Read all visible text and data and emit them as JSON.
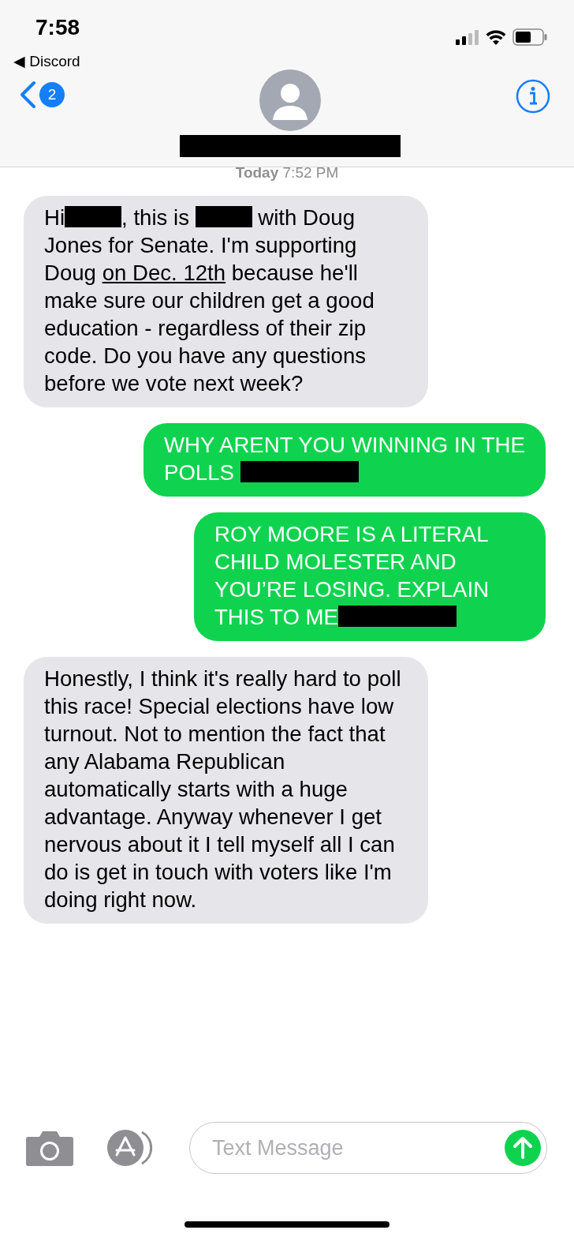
{
  "status_bar": {
    "time": "7:58",
    "back_app": "◀ Discord"
  },
  "header": {
    "unread_count": "2"
  },
  "timestamp": {
    "day": "Today",
    "time": "7:52 PM"
  },
  "messages": [
    {
      "sent": false,
      "parts": [
        {
          "kind": "text",
          "text": "Hi"
        },
        {
          "kind": "redaction"
        },
        {
          "kind": "text",
          "text": ", this is "
        },
        {
          "kind": "redaction"
        },
        {
          "kind": "text",
          "text": " with Doug Jones for Senate. I'm supporting Doug "
        },
        {
          "kind": "link",
          "text": "on Dec. 12th"
        },
        {
          "kind": "text",
          "text": " because he'll make sure our children get a good education - regardless of their zip code. Do you have any questions before we vote next week?"
        }
      ]
    },
    {
      "sent": true,
      "parts": [
        {
          "kind": "text",
          "text": "WHY ARENT YOU WINNING IN THE POLLS "
        },
        {
          "kind": "redaction"
        }
      ]
    },
    {
      "sent": true,
      "parts": [
        {
          "kind": "text",
          "text": "ROY MOORE IS A LITERAL CHILD MOLESTER AND YOU’RE LOSING. EXPLAIN THIS TO ME"
        },
        {
          "kind": "redaction"
        }
      ]
    },
    {
      "sent": false,
      "parts": [
        {
          "kind": "text",
          "text": "Honestly, I think it's really hard to poll this race! Special elections have low turnout. Not to mention the fact that any Alabama Republican automatically starts with a huge advantage. Anyway whenever I get nervous about it I tell myself all I can do is get in touch with voters like I'm doing right now."
        }
      ]
    }
  ],
  "composer": {
    "placeholder": "Text Message"
  }
}
